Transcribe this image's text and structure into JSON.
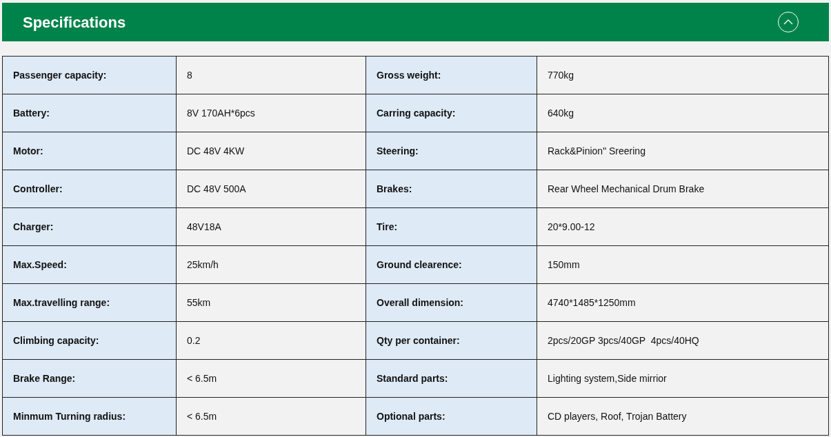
{
  "header": {
    "title": "Specifications",
    "expanded": true
  },
  "rows": [
    {
      "left": {
        "label": "Passenger capacity:",
        "value": "8"
      },
      "right": {
        "label": "Gross weight:",
        "value": "770kg"
      }
    },
    {
      "left": {
        "label": "Battery:",
        "value": "8V 170AH*6pcs"
      },
      "right": {
        "label": "Carring capacity:",
        "value": "640kg"
      }
    },
    {
      "left": {
        "label": "Motor:",
        "value": "DC 48V 4KW"
      },
      "right": {
        "label": "Steering:",
        "value": "Rack&Pinion\" Sreering"
      }
    },
    {
      "left": {
        "label": "Controller:",
        "value": "DC 48V 500A"
      },
      "right": {
        "label": "Brakes:",
        "value": "Rear Wheel Mechanical Drum Brake"
      }
    },
    {
      "left": {
        "label": "Charger:",
        "value": "48V18A"
      },
      "right": {
        "label": "Tire:",
        "value": "20*9.00-12"
      }
    },
    {
      "left": {
        "label": "Max.Speed:",
        "value": "25km/h"
      },
      "right": {
        "label": "Ground clearence:",
        "value": "150mm"
      }
    },
    {
      "left": {
        "label": "Max.travelling range:",
        "value": "55km"
      },
      "right": {
        "label": "Overall dimension:",
        "value": "4740*1485*1250mm"
      }
    },
    {
      "left": {
        "label": "Climbing capacity:",
        "value": "0.2"
      },
      "right": {
        "label": "Qty per container:",
        "value": "2pcs/20GP 3pcs/40GP  4pcs/40HQ"
      }
    },
    {
      "left": {
        "label": "Brake Range:",
        "value": "< 6.5m"
      },
      "right": {
        "label": "Standard parts:",
        "value": "Lighting system,Side mirrior"
      }
    },
    {
      "left": {
        "label": "Minmum Turning radius:",
        "value": "< 6.5m"
      },
      "right": {
        "label": "Optional parts:",
        "value": "CD players, Roof, Trojan Battery"
      }
    }
  ]
}
